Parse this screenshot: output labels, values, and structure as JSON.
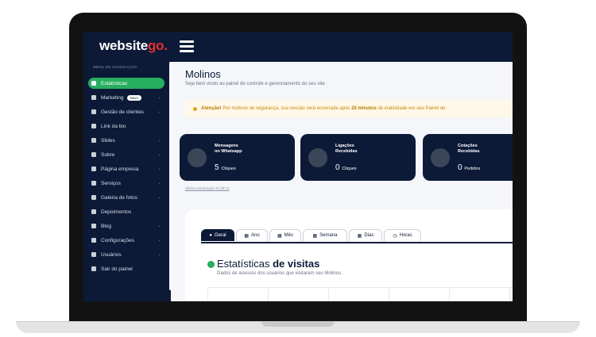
{
  "header": {
    "logo_main": "website",
    "logo_accent": "go",
    "logo_dot": "."
  },
  "sidebar": {
    "heading": "MENU DE NAVEGAÇÃO",
    "items": [
      {
        "label": "Estatísticas",
        "icon": "chart-pie-icon",
        "active": true,
        "chevron": false
      },
      {
        "label": "Marketing",
        "icon": "chart-line-icon",
        "badge": "Novo",
        "chevron": true
      },
      {
        "label": "Gestão de clientes",
        "icon": "users-icon",
        "chevron": true
      },
      {
        "label": "Link da bio",
        "icon": "share-icon",
        "chevron": false
      },
      {
        "label": "Slides",
        "icon": "slides-icon",
        "chevron": true
      },
      {
        "label": "Sobre",
        "icon": "file-icon",
        "chevron": true
      },
      {
        "label": "Página empresa",
        "icon": "page-icon",
        "chevron": true
      },
      {
        "label": "Serviços",
        "icon": "handshake-icon",
        "chevron": true
      },
      {
        "label": "Galeria de fotos",
        "icon": "camera-icon",
        "chevron": true
      },
      {
        "label": "Depoimentos",
        "icon": "quote-icon",
        "chevron": false
      },
      {
        "label": "Blog",
        "icon": "blog-icon",
        "chevron": true
      },
      {
        "label": "Configurações",
        "icon": "gear-icon",
        "chevron": true
      },
      {
        "label": "Usuários",
        "icon": "user-icon",
        "chevron": true
      },
      {
        "label": "Sair do painel",
        "icon": "logout-icon",
        "chevron": false
      }
    ]
  },
  "main": {
    "title": "Molinos",
    "subtitle": "Seja bem vindo ao painel de controle e gerenciamento do seu site",
    "alert": {
      "prefix": "Atenção!",
      "text": " Por motivos de segurança, sua sessão será encerrada após ",
      "bold": "20 minutos",
      "suffix": " de inatividade em seu Painel de"
    },
    "cards": [
      {
        "title1": "Mensagens",
        "title2": "no Whatsapp",
        "value": "5",
        "unit": "Cliques",
        "icon": "whatsapp-icon"
      },
      {
        "title1": "Ligações",
        "title2": "Recebidas",
        "value": "0",
        "unit": "Cliques",
        "icon": "phone-icon"
      },
      {
        "title1": "Cotações",
        "title2": "Recebidas",
        "value": "0",
        "unit": "Pedidos",
        "icon": "cart-icon"
      }
    ],
    "updated": "Última atualização 21:28:12",
    "tabs": [
      {
        "label": "Geral",
        "icon": "●"
      },
      {
        "label": "Ano",
        "icon": "▦"
      },
      {
        "label": "Mês",
        "icon": "▦"
      },
      {
        "label": "Semana",
        "icon": "▦"
      },
      {
        "label": "Dias",
        "icon": "▦"
      },
      {
        "label": "Horas",
        "icon": "◷"
      }
    ],
    "stats": {
      "title_light": "Estatísticas ",
      "title_bold": "de visitas",
      "subtitle": "Dados de acessos dos usuários que visitaram seu Molinos."
    }
  }
}
